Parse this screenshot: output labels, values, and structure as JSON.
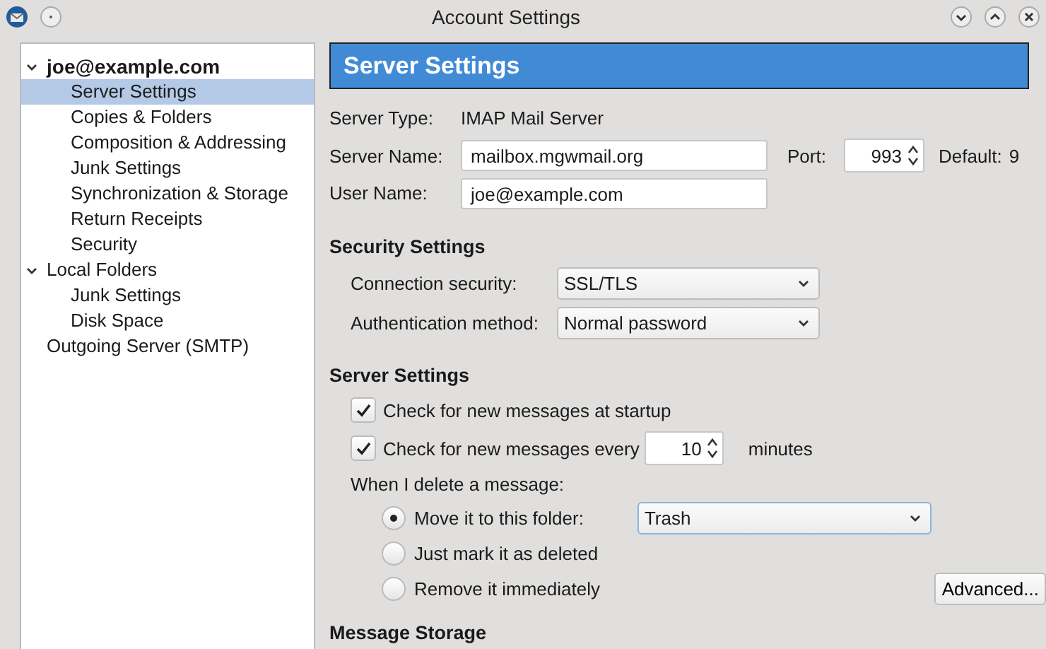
{
  "window": {
    "title": "Account Settings"
  },
  "sidebar": {
    "tree": [
      {
        "label": "joe@example.com",
        "expanded": true,
        "selected": false,
        "children": [
          {
            "label": "Server Settings",
            "selected": true
          },
          {
            "label": "Copies & Folders",
            "selected": false
          },
          {
            "label": "Composition & Addressing",
            "selected": false
          },
          {
            "label": "Junk Settings",
            "selected": false
          },
          {
            "label": "Synchronization & Storage",
            "selected": false
          },
          {
            "label": "Return Receipts",
            "selected": false
          },
          {
            "label": "Security",
            "selected": false
          }
        ]
      },
      {
        "label": "Local Folders",
        "expanded": true,
        "selected": false,
        "children": [
          {
            "label": "Junk Settings",
            "selected": false
          },
          {
            "label": "Disk Space",
            "selected": false
          }
        ]
      },
      {
        "label": "Outgoing Server (SMTP)",
        "selected": false
      }
    ]
  },
  "header": {
    "title": "Server Settings"
  },
  "server_type": {
    "label": "Server Type:",
    "value": "IMAP Mail Server"
  },
  "server_name": {
    "label": "Server Name:",
    "value": "mailbox.mgwmail.org"
  },
  "port": {
    "label": "Port:",
    "value": "993"
  },
  "default_port": {
    "label": "Default:",
    "value": "9"
  },
  "user_name": {
    "label": "User Name:",
    "value": "joe@example.com"
  },
  "security_settings": {
    "heading": "Security Settings",
    "rows": [
      {
        "label": "Connection security:",
        "value": "SSL/TLS"
      },
      {
        "label": "Authentication method:",
        "value": "Normal password"
      }
    ]
  },
  "server_settings": {
    "heading": "Server Settings",
    "checks": [
      {
        "label": "Check for new messages at startup",
        "checked": true
      },
      {
        "label": "Check for new messages every",
        "checked": true,
        "value": "10",
        "unit": "minutes"
      }
    ],
    "delete_label": "When I delete a message:",
    "delete_options": [
      {
        "label": "Move it to this folder:",
        "selected": true,
        "folder": "Trash"
      },
      {
        "label": "Just mark it as deleted",
        "selected": false
      },
      {
        "label": "Remove it immediately",
        "selected": false
      }
    ],
    "advanced_button": "Advanced..."
  },
  "message_storage": {
    "heading": "Message Storage"
  }
}
